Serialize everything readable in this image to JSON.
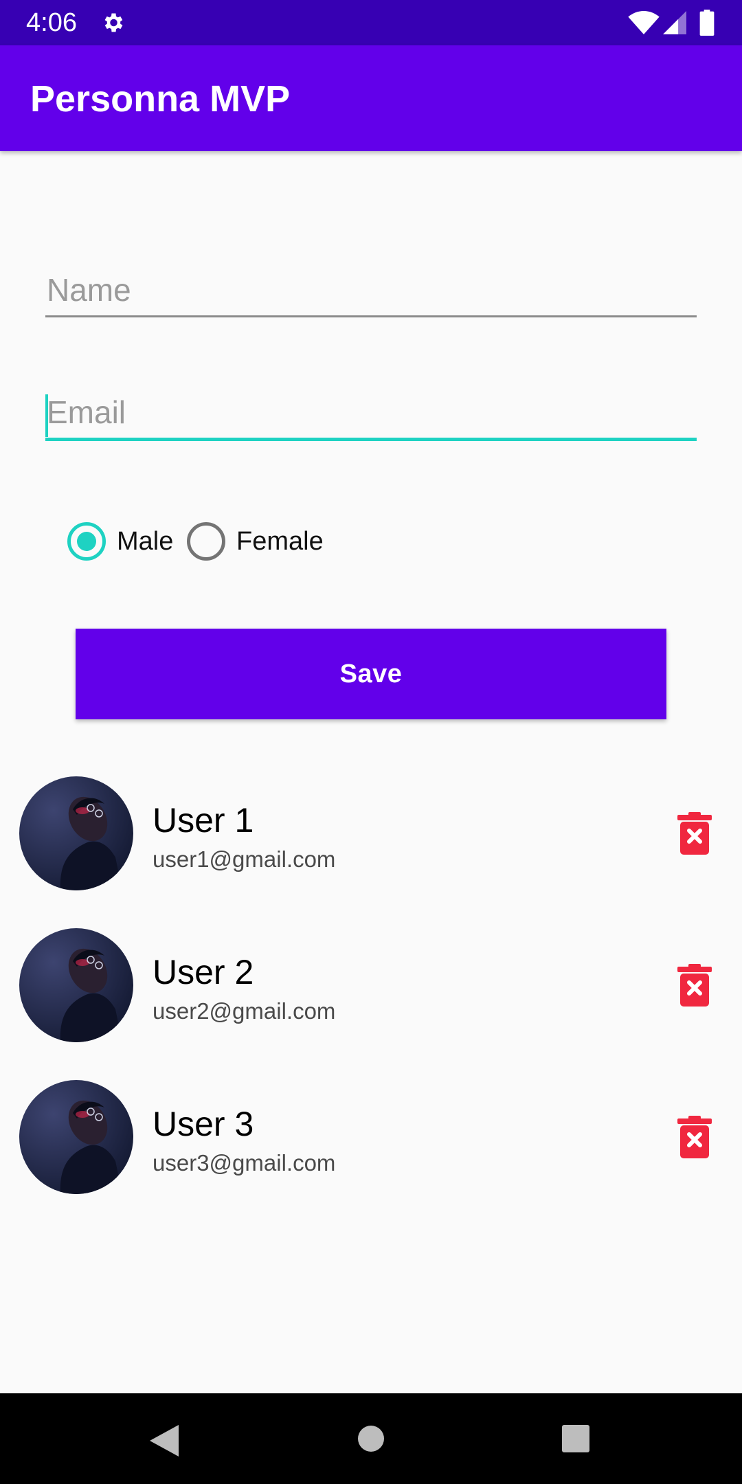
{
  "status_bar": {
    "time": "4:06",
    "icons": [
      "settings-gear-icon",
      "wifi-icon",
      "cell-signal-icon",
      "battery-icon"
    ]
  },
  "app_bar": {
    "title": "Personna MVP"
  },
  "form": {
    "name_placeholder": "Name",
    "name_value": "",
    "email_placeholder": "Email",
    "email_value": "",
    "gender_options": [
      {
        "label": "Male",
        "checked": true
      },
      {
        "label": "Female",
        "checked": false
      }
    ],
    "save_label": "Save"
  },
  "users": [
    {
      "name": "User 1",
      "email": "user1@gmail.com"
    },
    {
      "name": "User 2",
      "email": "user2@gmail.com"
    },
    {
      "name": "User 3",
      "email": "user3@gmail.com"
    }
  ],
  "nav_bar": {
    "icons": [
      "back-icon",
      "home-icon",
      "recents-icon"
    ]
  },
  "colors": {
    "status_bar": "#3700b3",
    "primary": "#6200ea",
    "accent": "#1ed2c2",
    "delete": "#f0273f",
    "background": "#fafafa"
  }
}
